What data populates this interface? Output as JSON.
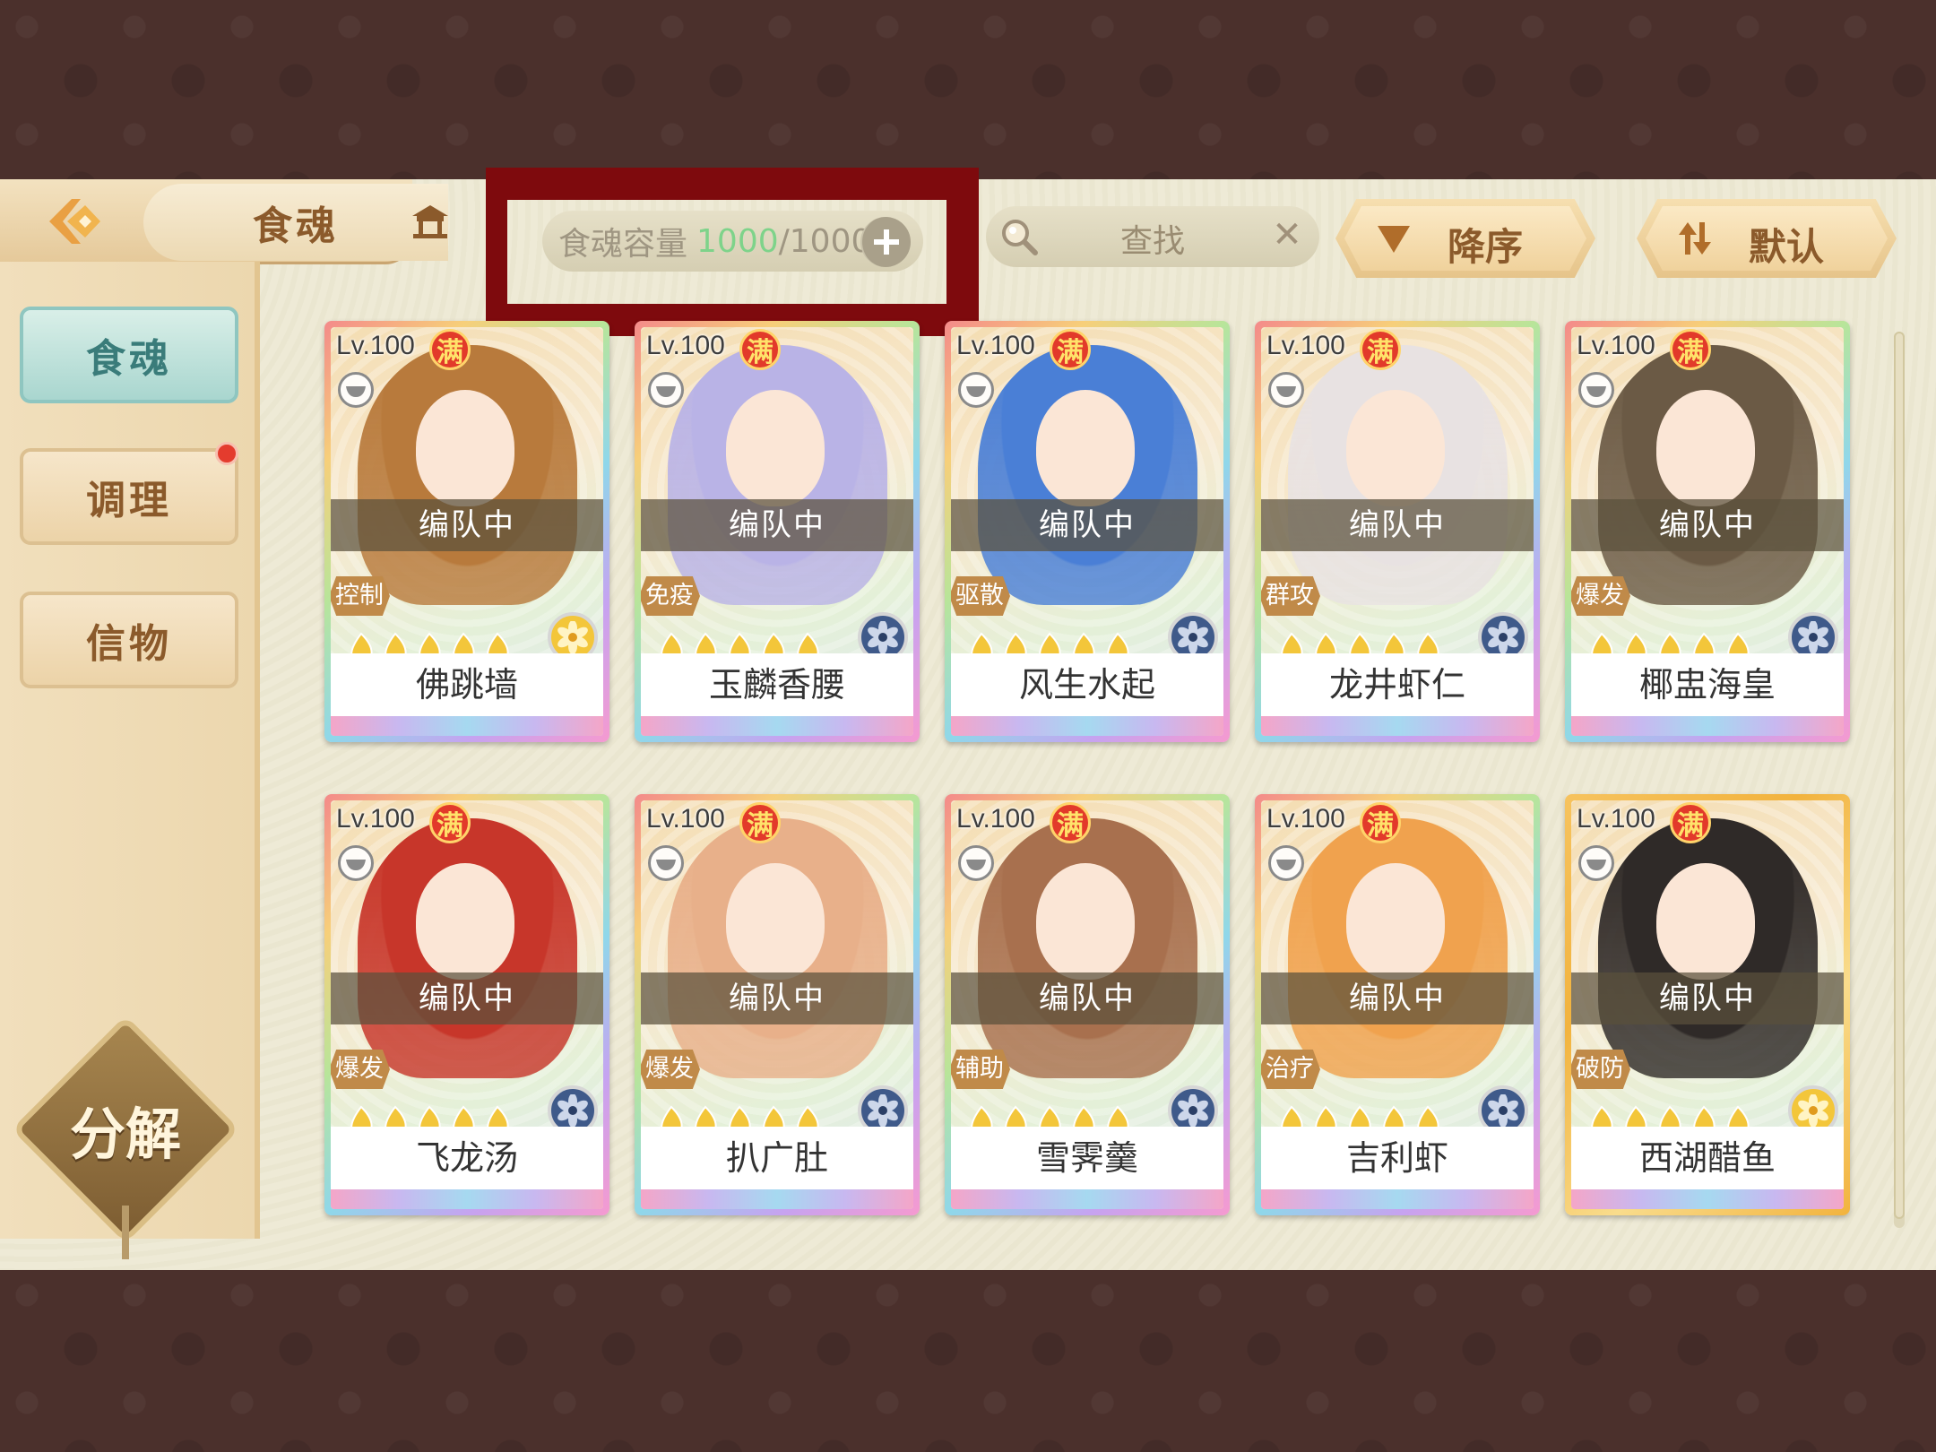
{
  "header": {
    "title": "食魂",
    "capacity": {
      "label": "食魂容量",
      "current": "1000",
      "separator": "/",
      "max": "1000"
    },
    "search": {
      "label": "查找"
    },
    "sort_order": "降序",
    "sort_mode": "默认"
  },
  "sidebar": {
    "tabs": [
      {
        "label": "食魂",
        "active": true
      },
      {
        "label": "调理",
        "active": false,
        "notification": true
      },
      {
        "label": "信物",
        "active": false
      }
    ],
    "decompose_label": "分解"
  },
  "cards": [
    {
      "level": "Lv.100",
      "max": "满",
      "status": "编队中",
      "role": "控制",
      "name": "佛跳墙",
      "hair": "#b87a3c",
      "element": "gold",
      "frame": "rainbow"
    },
    {
      "level": "Lv.100",
      "max": "满",
      "status": "编队中",
      "role": "免疫",
      "name": "玉麟香腰",
      "hair": "#b9b3e6",
      "element": "blue",
      "frame": "rainbow"
    },
    {
      "level": "Lv.100",
      "max": "满",
      "status": "编队中",
      "role": "驱散",
      "name": "风生水起",
      "hair": "#4a7fd6",
      "element": "blue",
      "frame": "rainbow"
    },
    {
      "level": "Lv.100",
      "max": "满",
      "status": "编队中",
      "role": "群攻",
      "name": "龙井虾仁",
      "hair": "#e8e2e2",
      "element": "blue",
      "frame": "rainbow"
    },
    {
      "level": "Lv.100",
      "max": "满",
      "status": "编队中",
      "role": "爆发",
      "name": "椰盅海皇",
      "hair": "#6b5a45",
      "element": "blue",
      "frame": "rainbow"
    },
    {
      "level": "Lv.100",
      "max": "满",
      "status": "编队中",
      "role": "爆发",
      "name": "飞龙汤",
      "hair": "#c7362a",
      "element": "blue",
      "frame": "rainbow"
    },
    {
      "level": "Lv.100",
      "max": "满",
      "status": "编队中",
      "role": "爆发",
      "name": "扒广肚",
      "hair": "#e8b08a",
      "element": "blue",
      "frame": "rainbow"
    },
    {
      "level": "Lv.100",
      "max": "满",
      "status": "编队中",
      "role": "辅助",
      "name": "雪霁羹",
      "hair": "#a8704e",
      "element": "blue",
      "frame": "rainbow"
    },
    {
      "level": "Lv.100",
      "max": "满",
      "status": "编队中",
      "role": "治疗",
      "name": "吉利虾",
      "hair": "#f0a24e",
      "element": "blue",
      "frame": "rainbow"
    },
    {
      "level": "Lv.100",
      "max": "满",
      "status": "编队中",
      "role": "破防",
      "name": "西湖醋鱼",
      "hair": "#2f2a28",
      "element": "gold",
      "frame": "gold"
    }
  ],
  "icons": {
    "back": "back-arrow-icon",
    "crown": "pavilion-icon",
    "search": "magnifier-icon",
    "clear": "close-icon",
    "sort_order": "triangle-down-icon",
    "sort_mode": "swap-arrows-icon",
    "add": "plus-icon"
  },
  "stars_text": "🔥🔥🔥🔥🔥"
}
